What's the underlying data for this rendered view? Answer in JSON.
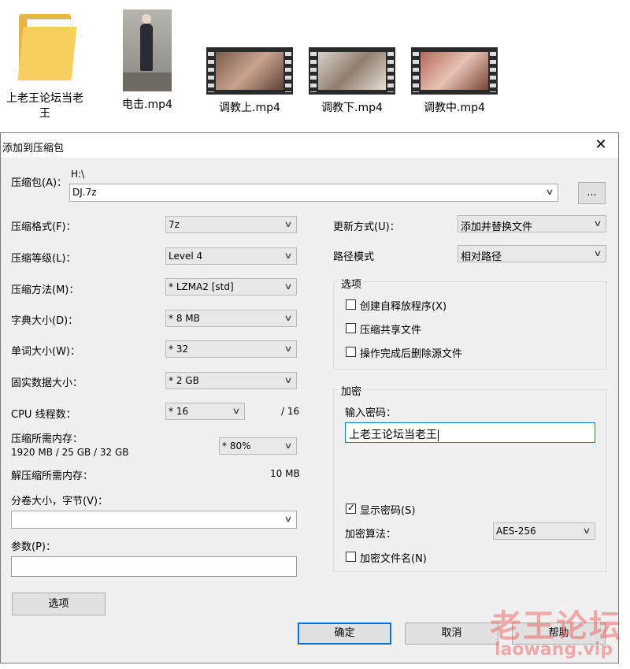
{
  "desktop": {
    "files": [
      {
        "name": "上老王论坛当老王",
        "icon": "folder-icon"
      },
      {
        "name": "电击.mp4",
        "icon": "video-thumbnail-icon"
      },
      {
        "name": "调教上.mp4",
        "icon": "video-film-icon"
      },
      {
        "name": "调教下.mp4",
        "icon": "video-film-icon"
      },
      {
        "name": "调教中.mp4",
        "icon": "video-film-icon"
      }
    ]
  },
  "dialog": {
    "title": "添加到压缩包",
    "archive": {
      "label": "压缩包(A)：",
      "path": "H:\\",
      "value": "DJ.7z",
      "browse": "..."
    },
    "format": {
      "label": "压缩格式(F)：",
      "value": "7z"
    },
    "level": {
      "label": "压缩等级(L)：",
      "value": "Level 4"
    },
    "method": {
      "label": "压缩方法(M)：",
      "value": "* LZMA2 [std]"
    },
    "dict": {
      "label": "字典大小(D)：",
      "value": "* 8 MB"
    },
    "word": {
      "label": "单词大小(W)：",
      "value": "* 32"
    },
    "solid": {
      "label": "固实数据大小：",
      "value": "* 2 GB"
    },
    "threads": {
      "label": "CPU 线程数：",
      "value": "* 16",
      "max": "/ 16"
    },
    "mem_comp": {
      "label": "压缩所需内存：",
      "detail": "1920 MB / 25 GB / 32 GB",
      "value": "* 80%"
    },
    "mem_decomp": {
      "label": "解压缩所需内存：",
      "value": "10 MB"
    },
    "volume": {
      "label": "分卷大小，字节(V)：",
      "value": ""
    },
    "params": {
      "label": "参数(P)：",
      "value": ""
    },
    "options_button": "选项",
    "update": {
      "label": "更新方式(U)：",
      "value": "添加并替换文件"
    },
    "pathmode": {
      "label": "路径模式",
      "value": "相对路径"
    },
    "options": {
      "title": "选项",
      "sfx": {
        "label": "创建自释放程序(X)",
        "checked": false
      },
      "shared": {
        "label": "压缩共享文件",
        "checked": false
      },
      "delete": {
        "label": "操作完成后删除源文件",
        "checked": false
      }
    },
    "encryption": {
      "title": "加密",
      "pw_label": "输入密码：",
      "pw_value": "上老王论坛当老王",
      "show_pw": {
        "label": "显示密码(S)",
        "checked": true
      },
      "method_label": "加密算法：",
      "method_value": "AES-256",
      "encrypt_names": {
        "label": "加密文件名(N)",
        "checked": false
      }
    },
    "buttons": {
      "ok": "确定",
      "cancel": "取消",
      "help": "帮助"
    }
  },
  "watermark": {
    "line1": "老王论坛",
    "line2": "laowang.vip"
  }
}
